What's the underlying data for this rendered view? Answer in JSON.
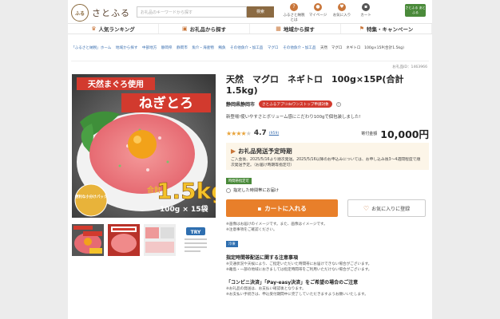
{
  "header": {
    "logo_text": "さとふる",
    "search_placeholder": "お礼品のキーワードから探す",
    "search_button": "検索",
    "icons": [
      {
        "name": "calendar-icon",
        "label": "ふるさと納税とは"
      },
      {
        "name": "user-icon",
        "label": "マイページ"
      },
      {
        "name": "heart-icon",
        "label": "お気に入り"
      },
      {
        "name": "cart-icon",
        "label": "カート"
      }
    ],
    "app_badge": "さとふる あとふる"
  },
  "nav": [
    {
      "icon": "crown-icon",
      "label": "人気ランキング"
    },
    {
      "icon": "gift-icon",
      "label": "お礼品から探す"
    },
    {
      "icon": "map-icon",
      "label": "地域から探す"
    },
    {
      "icon": "flag-icon",
      "label": "特集・キャンペーン"
    }
  ],
  "breadcrumb": [
    "「ふるさと納税」ホーム",
    "地域から探す",
    "中部地方",
    "静岡県",
    "静岡市",
    "魚介・海産物",
    "鮪魚",
    "その他魚介・加工品",
    "マグロ",
    "その他魚介・加工品"
  ],
  "breadcrumb_current": "天然　マグロ　ネギトロ　100g×15P(合計1.5kg)",
  "product": {
    "id_text": "お礼品ID：1463966",
    "title": "天然　マグロ　ネギトロ　100g×15P(合計1.5kg)",
    "location": "静岡県静岡市",
    "app_badge": "さとふるアプリdeワンストップ申請対象",
    "description": "新登場!使いやすさとボリューム感にこだわり100gで個包装しました!",
    "rating": "4.7",
    "rating_value": 4.7,
    "review_count": "(959)",
    "price_label": "寄付金額",
    "price": "10,000円"
  },
  "image_text": {
    "banner": "天然まぐろ使用",
    "name": "ねぎとろ",
    "total_label": "合計",
    "total": "1.5kg",
    "pack": "100g × 15袋",
    "side": "便利な小分けパック"
  },
  "shipping": {
    "title": "お礼品発送予定時期",
    "detail": "ご入金後、2025/5/16より順次発送。2025/5/16以降のお申込みについては、お申し込み後3～4週間程度で順次発送予定。（お届け時期等指定可）"
  },
  "delivery": {
    "badge": "時間帯指定可",
    "option": "指定した時間帯にお届け"
  },
  "buttons": {
    "cart": "カートに入れる",
    "favorite": "お気に入りに登録"
  },
  "notes": [
    "※画像はお届けのイメージです。また、画像はイメージです。",
    "※注意事項をご確認ください。"
  ],
  "freeze_badge": "冷凍",
  "section1": {
    "heading": "指定時間帯配送に関する注意事項",
    "lines": [
      "※交通状況や天候により、ご指定いただいた時間帯にお届けできない場合がございます。",
      "※離島・一部の地域におきましては指定時間帯をご利用いただけない場合がございます。"
    ]
  },
  "section2": {
    "heading": "「コンビニ決済」「Pay-easy決済」をご希望の場合のご注意",
    "lines": [
      "※お礼品の発送は、お支払い確認後となります。",
      "※お支払い手続きは、申込受付期間中に完了していただきますようお願いいたします。"
    ]
  },
  "colors": {
    "accent": "#e87f2a",
    "brand": "#8b6a42",
    "red": "#d23a2e",
    "green": "#4a8a3a",
    "link": "#3a6fb0"
  }
}
